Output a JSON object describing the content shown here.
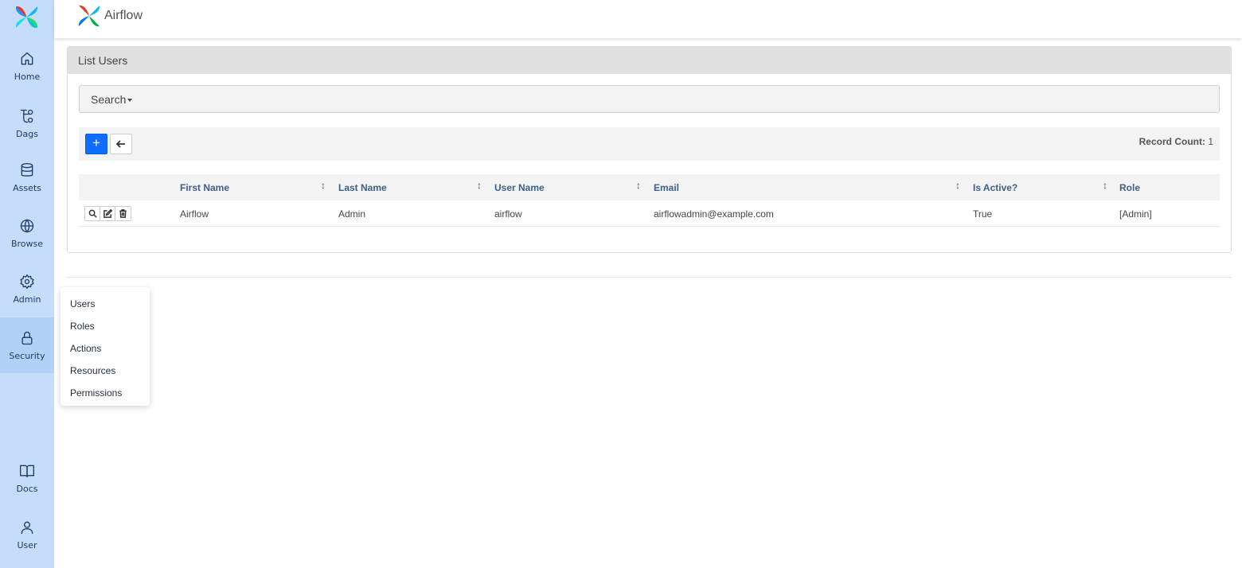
{
  "app": {
    "title": "Airflow"
  },
  "sidebar": {
    "items": [
      {
        "label": "Home",
        "icon": "home-icon"
      },
      {
        "label": "Dags",
        "icon": "dags-icon"
      },
      {
        "label": "Assets",
        "icon": "database-icon"
      },
      {
        "label": "Browse",
        "icon": "globe-icon"
      },
      {
        "label": "Admin",
        "icon": "gear-icon"
      },
      {
        "label": "Security",
        "icon": "lock-icon",
        "active": true
      },
      {
        "label": "Docs",
        "icon": "book-icon"
      },
      {
        "label": "User",
        "icon": "user-icon"
      }
    ]
  },
  "panel": {
    "title": "List Users"
  },
  "search": {
    "label": "Search"
  },
  "actions": {
    "add_label": "+",
    "record_count_label": "Record Count:",
    "record_count": "1"
  },
  "table": {
    "headers": [
      "First Name",
      "Last Name",
      "User Name",
      "Email",
      "Is Active?",
      "Role"
    ],
    "rows": [
      {
        "first_name": "Airflow",
        "last_name": "Admin",
        "user_name": "airflow",
        "email": "airflowadmin@example.com",
        "is_active": "True",
        "role": "[Admin]"
      }
    ]
  },
  "security_menu": {
    "items": [
      "Users",
      "Roles",
      "Actions",
      "Resources",
      "Permissions"
    ]
  },
  "colors": {
    "sidebar": "#c5dcfb",
    "primary": "#0d6efd",
    "header_text": "#3e5f86"
  }
}
